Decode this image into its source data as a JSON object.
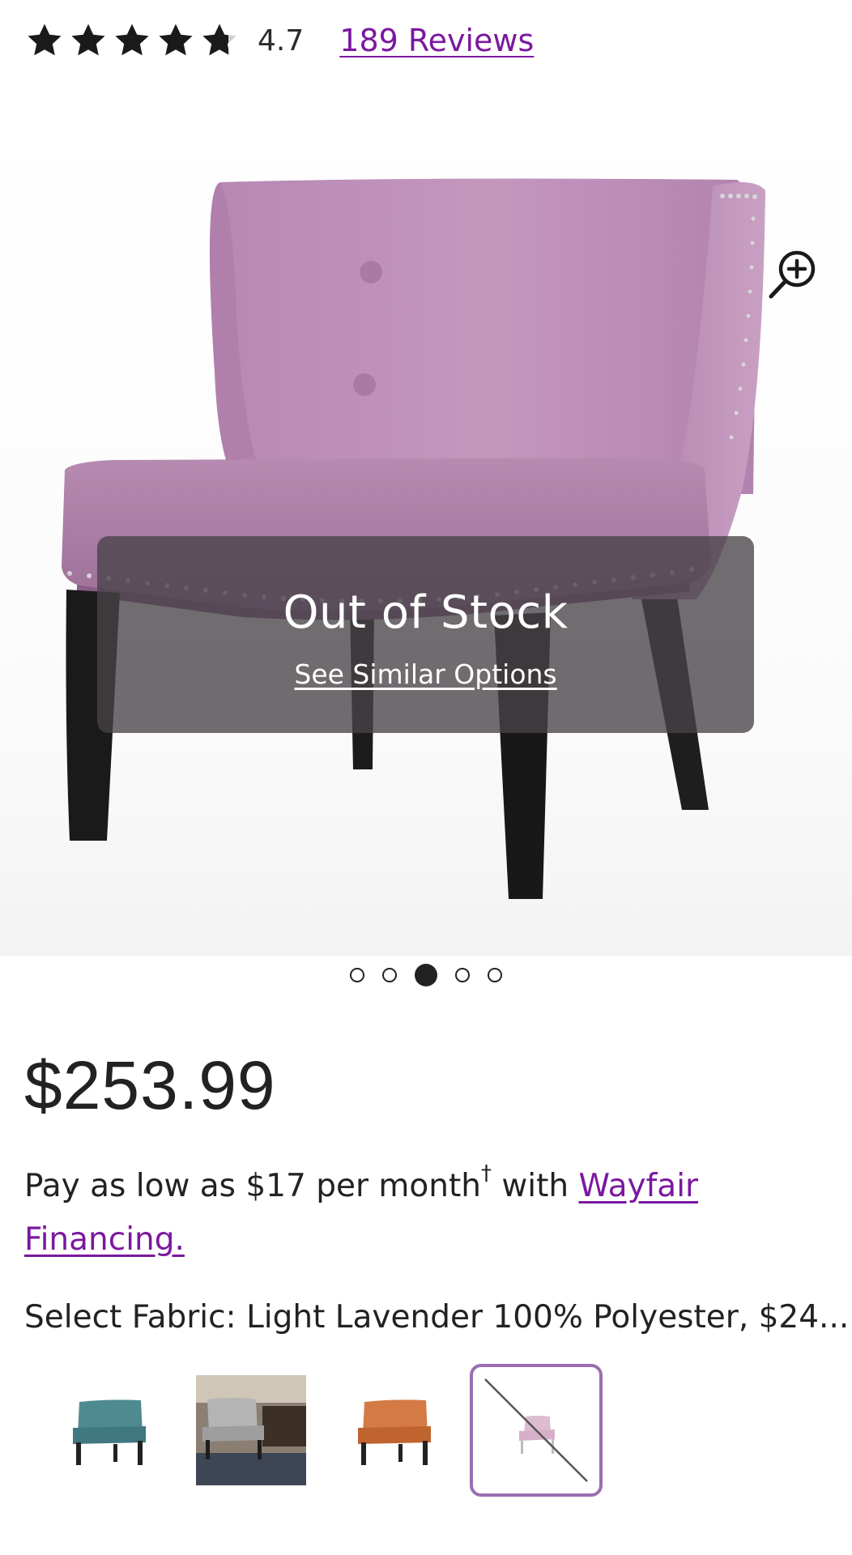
{
  "rating": {
    "stars_filled": 4.7,
    "value_text": "4.7",
    "reviews_text": "189 Reviews"
  },
  "product_image": {
    "overlay_title": "Out of Stock",
    "overlay_link": "See Similar Options",
    "zoom_icon": "zoom-in-icon",
    "slides_count": 5,
    "active_slide": 3
  },
  "price": {
    "amount": "$253.99",
    "financing_prefix": "Pay as low as $17 per month",
    "financing_dagger": "†",
    "financing_middle": " with ",
    "financing_link": "Wayfair Financing."
  },
  "fabric": {
    "label": "Select Fabric: Light Lavender 100% Polyester, $24...",
    "swatches": [
      {
        "name": "teal",
        "color": "#4f8a91",
        "selected": false,
        "available": true
      },
      {
        "name": "gray",
        "color": "#9c9c9c",
        "selected": false,
        "available": true
      },
      {
        "name": "orange",
        "color": "#d0703a",
        "selected": false,
        "available": true
      },
      {
        "name": "light-lavender",
        "color": "#dcb9cf",
        "selected": true,
        "available": false
      }
    ]
  },
  "colors": {
    "accent_purple": "#7b189f",
    "chair_fabric": "#b98cb4",
    "legs": "#1d1d1d",
    "overlay": "#484248"
  }
}
